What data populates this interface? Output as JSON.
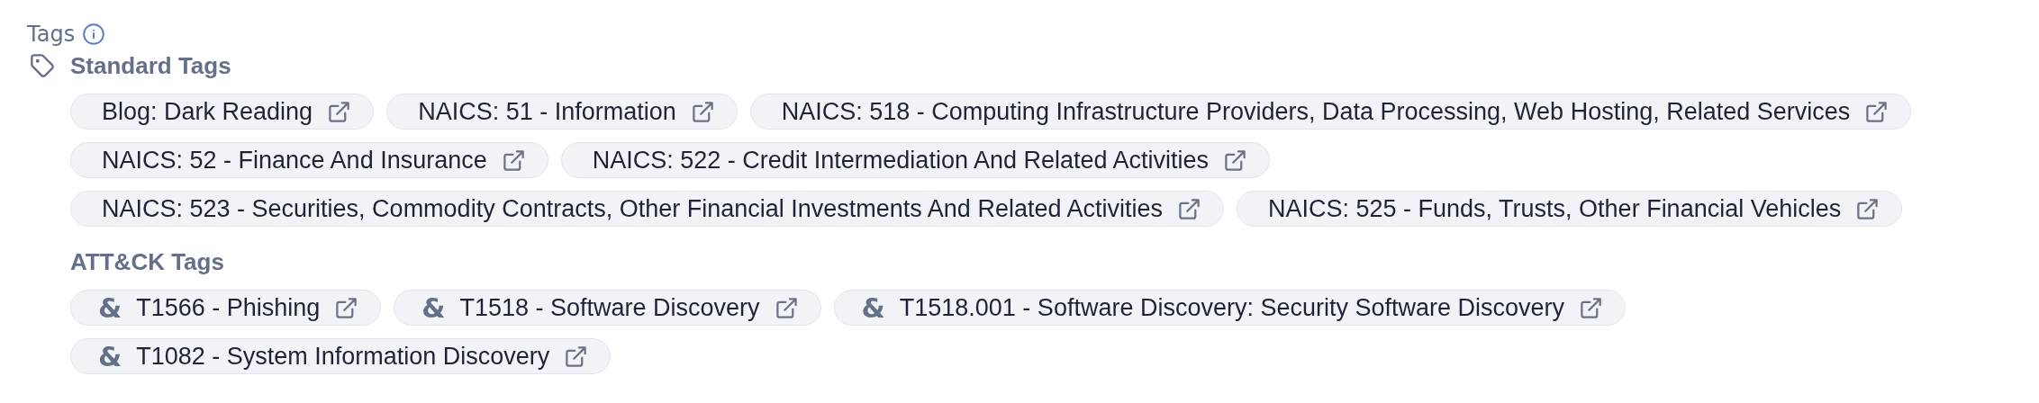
{
  "title": "Tags",
  "sections": [
    {
      "kind": "standard",
      "heading": "Standard Tags",
      "tags": [
        {
          "label": "Blog: Dark Reading"
        },
        {
          "label": "NAICS: 51 - Information"
        },
        {
          "label": "NAICS: 518 - Computing Infrastructure Providers, Data Processing, Web Hosting, Related Services"
        },
        {
          "label": "NAICS: 52 - Finance And Insurance"
        },
        {
          "label": "NAICS: 522 - Credit Intermediation And Related Activities"
        },
        {
          "label": "NAICS: 523 - Securities, Commodity Contracts, Other Financial Investments And Related Activities"
        },
        {
          "label": "NAICS: 525 - Funds, Trusts, Other Financial Vehicles"
        }
      ]
    },
    {
      "kind": "attack",
      "heading": "ATT&CK Tags",
      "tags": [
        {
          "glyph": "&",
          "label": "T1566 - Phishing"
        },
        {
          "glyph": "&",
          "label": "T1518 - Software Discovery"
        },
        {
          "glyph": "&",
          "label": "T1518.001 - Software Discovery: Security Software Discovery"
        },
        {
          "glyph": "&",
          "label": "T1082 - System Information Discovery"
        }
      ]
    }
  ]
}
